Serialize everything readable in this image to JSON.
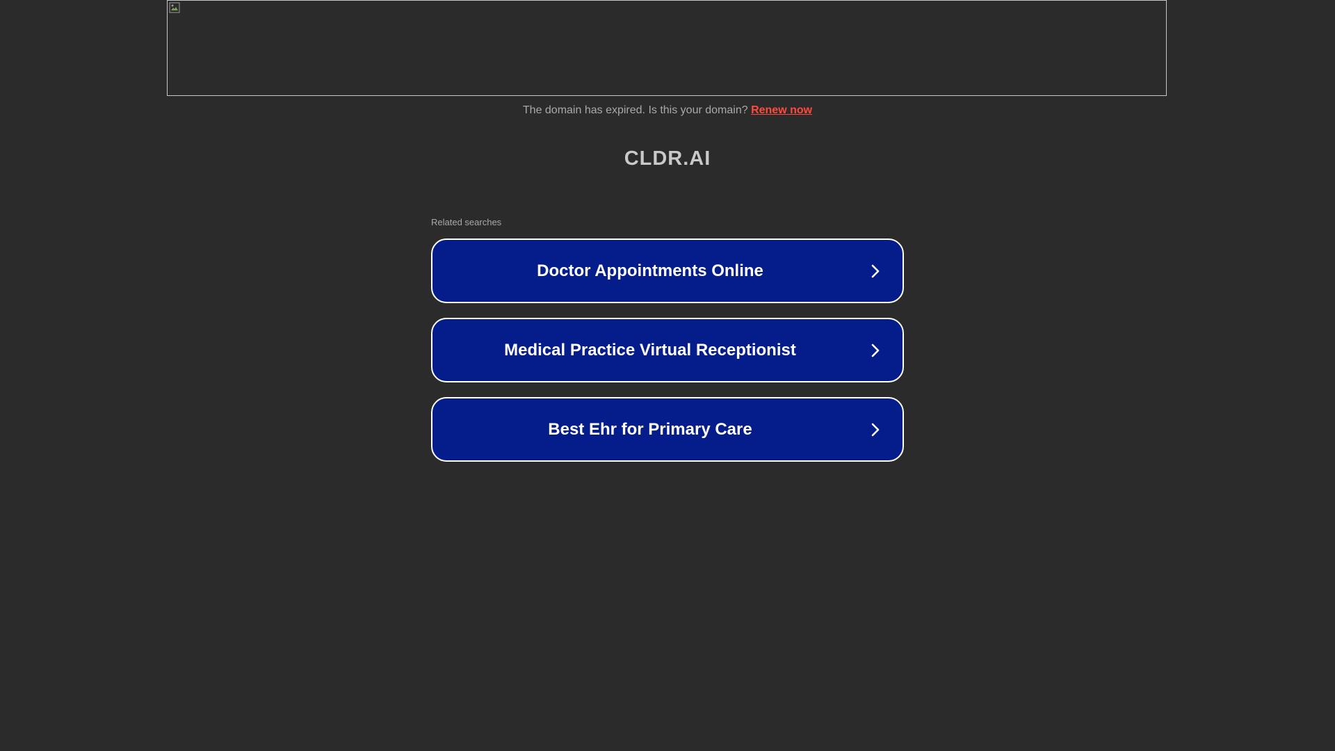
{
  "notice": {
    "text": "The domain has expired. Is this your domain?",
    "link_label": "Renew now",
    "link_color": "#ff4a3d"
  },
  "domain": {
    "title": "CLDR.AI"
  },
  "related": {
    "label": "Related searches",
    "items": [
      {
        "label": "Doctor Appointments Online",
        "icon": "chevron-right-icon"
      },
      {
        "label": "Medical Practice Virtual Receptionist",
        "icon": "chevron-right-icon"
      },
      {
        "label": "Best Ehr for Primary Care",
        "icon": "chevron-right-icon"
      }
    ]
  },
  "colors": {
    "background": "#2b2b2b",
    "button_bg": "#041d8a",
    "button_border": "#ffffff"
  }
}
